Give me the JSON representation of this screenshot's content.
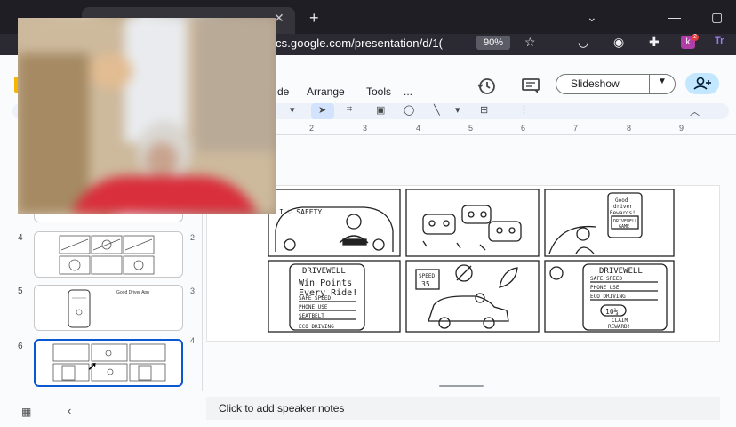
{
  "browser": {
    "url_visible": "cs.google.com/presentation/d/1(",
    "zoom": "90%",
    "tab_close_glyph": "✕",
    "new_tab_glyph": "+",
    "extension_badge_count": "2"
  },
  "menu": {
    "items": [
      "de",
      "Arrange",
      "Tools",
      "..."
    ]
  },
  "header": {
    "slideshow_label": "Slideshow"
  },
  "ruler": {
    "numbers": [
      "2",
      "3",
      "4",
      "5",
      "6",
      "7",
      "8",
      "9"
    ]
  },
  "vertical_ruler": {
    "numbers": [
      "1",
      "2",
      "3",
      "4"
    ]
  },
  "filmstrip": {
    "slides": [
      {
        "number": "4"
      },
      {
        "number": "5",
        "thumb_title": "Good Driver App"
      },
      {
        "number": "6",
        "selected": true
      }
    ]
  },
  "comic": {
    "panel1_sign": "I ♡ SAFETY",
    "panel3_phone": [
      "Good",
      "driver",
      "Rewards!"
    ],
    "panel3_game": [
      "DRIVEWELL",
      "GAME"
    ],
    "panel4_app": "DRIVEWELL",
    "panel4_heading": [
      "Win Points",
      "Every Ride!"
    ],
    "panel4_rows": [
      "SAFE SPEED",
      "PHONE USE",
      "SEATBELT",
      "ECO DRIVING"
    ],
    "panel5_sign": [
      "SPEED",
      "35"
    ],
    "panel6_app": "DRIVEWELL",
    "panel6_rows": [
      "SAFE SPEED",
      "PHONE USE",
      "ECO DRIVING"
    ],
    "panel6_points": "10⅓",
    "panel6_reward": [
      "CLAIM",
      "REWARD!"
    ]
  },
  "notes": {
    "placeholder": "Click to add speaker notes"
  },
  "colors": {
    "accent": "#0b57d0",
    "share_button": "#c2e7ff",
    "toolbar": "#edf2fa"
  }
}
